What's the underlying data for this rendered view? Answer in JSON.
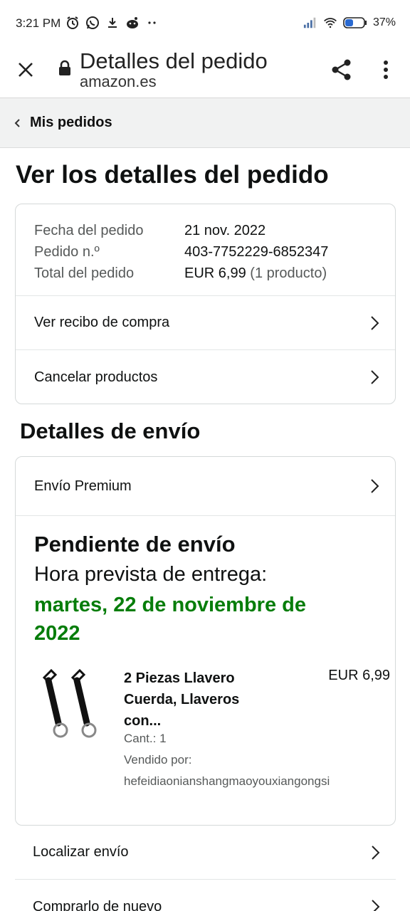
{
  "status_bar": {
    "time": "3:21 PM",
    "battery": "37%",
    "icons_left": [
      "alarm-icon",
      "whatsapp-icon",
      "download-icon",
      "reddit-icon",
      "more-dots-icon"
    ],
    "icons_right": [
      "signal-icon",
      "wifi-icon",
      "battery-icon"
    ]
  },
  "app_bar": {
    "title": "Detalles del pedido",
    "subtitle": "amazon.es"
  },
  "breadcrumb": {
    "label": "Mis pedidos"
  },
  "page": {
    "title": "Ver los detalles del pedido"
  },
  "order_info": {
    "rows": [
      {
        "label": "Fecha del pedido",
        "value": "21 nov. 2022",
        "extra": ""
      },
      {
        "label": "Pedido n.º",
        "value": "403-7752229-6852347",
        "extra": ""
      },
      {
        "label": "Total del pedido",
        "value": "EUR 6,99",
        "extra": "(1 producto)"
      }
    ],
    "links": [
      "Ver recibo de compra",
      "Cancelar productos"
    ]
  },
  "shipping": {
    "section_title": "Detalles de envío",
    "method": "Envío Premium",
    "status": "Pendiente de envío",
    "eta_label": "Hora prevista de entrega:",
    "eta_date": "martes, 22 de noviembre de 2022",
    "colors": {
      "eta": "#067d0a"
    }
  },
  "product": {
    "title": "2 Piezas Llavero Cuerda, Llaveros con...",
    "price": "EUR 6,99",
    "quantity": "Cant.: 1",
    "sold_by_label": "Vendido por:",
    "seller": "hefeidiaonianshangmaoyouxiangongsi"
  },
  "actions": [
    "Localizar envío",
    "Comprarlo de nuevo"
  ]
}
